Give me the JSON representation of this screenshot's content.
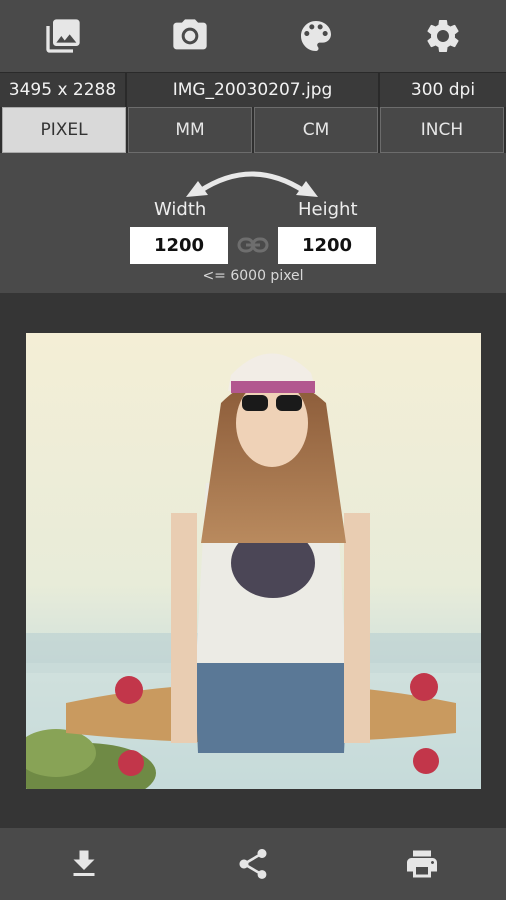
{
  "toolbar": {
    "icons": [
      "gallery-icon",
      "camera-icon",
      "palette-icon",
      "settings-icon"
    ]
  },
  "info": {
    "resolution": "3495 x 2288",
    "filename": "IMG_20030207.jpg",
    "dpi": "300 dpi"
  },
  "units": {
    "tabs": [
      "PIXEL",
      "MM",
      "CM",
      "INCH"
    ],
    "selected": "PIXEL"
  },
  "dimensions": {
    "width_label": "Width",
    "height_label": "Height",
    "width_value": "1200",
    "height_value": "1200",
    "limit_text": "<= 6000 pixel"
  },
  "bottom": {
    "icons": [
      "download-icon",
      "share-icon",
      "print-icon"
    ]
  },
  "colors": {
    "toolbar_bg": "#4a4a4a",
    "active_tab": "#d9d9d9",
    "page_bg": "#323232"
  }
}
